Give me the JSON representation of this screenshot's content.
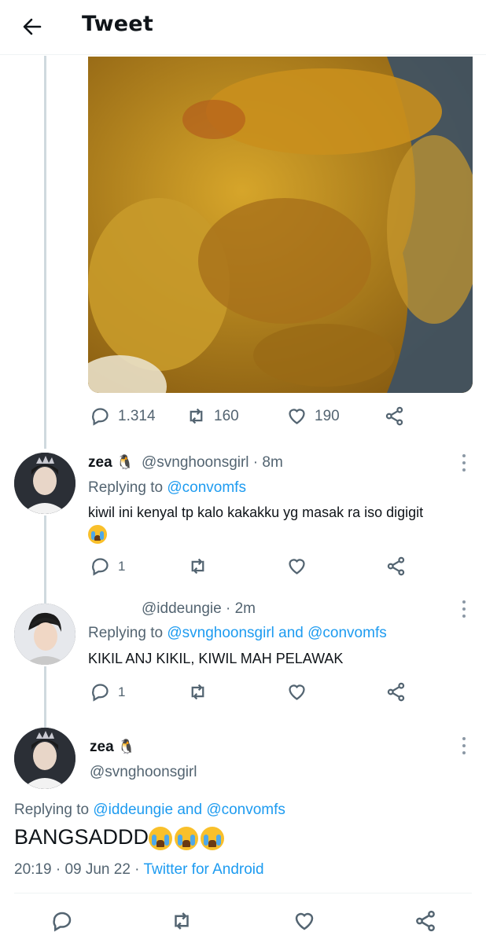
{
  "header": {
    "title": "Tweet",
    "back_icon": "arrow-left-icon"
  },
  "original_tweet": {
    "stats": {
      "replies": "1.314",
      "retweets": "160",
      "likes": "190"
    }
  },
  "replies": [
    {
      "name": "zea",
      "emoji": "🐧",
      "handle": "@svnghoonsgirl",
      "time": "8m",
      "replying_prefix": "Replying to ",
      "replying_to": "@convomfs",
      "replying_and": "",
      "replying_to_2": "",
      "text": "kiwil ini kenyal tp kalo kakakku yg masak ra iso digigit",
      "reply_count": "1"
    },
    {
      "name": "",
      "handle": "@iddeungie",
      "time": "2m",
      "replying_prefix": "Replying to ",
      "replying_to": "@svnghoonsgirl",
      "replying_and": " and ",
      "replying_to_2": "@convomfs",
      "text": "KIKIL ANJ KIKIL, KIWIL MAH PELAWAK",
      "reply_count": "1"
    }
  ],
  "main_tweet": {
    "name": "zea",
    "emoji": "🐧",
    "handle": "@svnghoonsgirl",
    "replying_prefix": "Replying to ",
    "replying_to": "@iddeungie",
    "replying_and": " and ",
    "replying_to_2": "@convomfs",
    "text": "BANGSADDD",
    "time": "20:19",
    "date": "09 Jun 22",
    "source": "Twitter for Android"
  },
  "colors": {
    "link": "#1d9bf0",
    "muted": "#536471",
    "thread_line": "#cfd9de"
  }
}
